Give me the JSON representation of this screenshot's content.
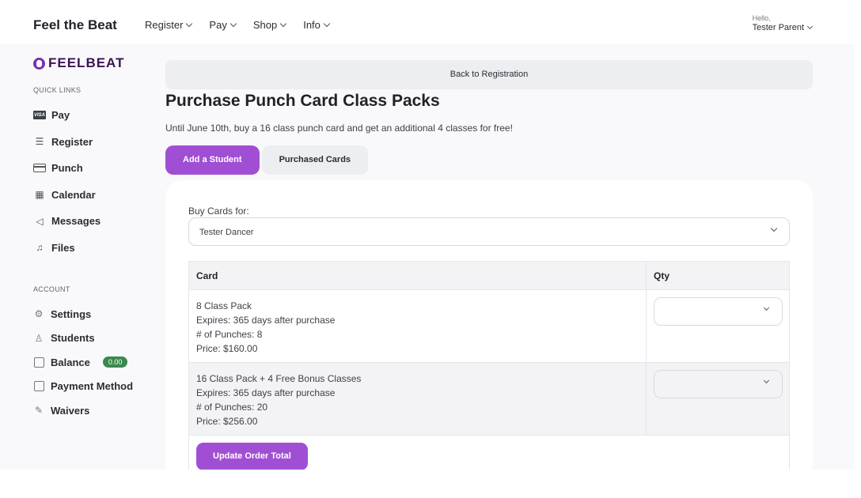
{
  "header": {
    "brand": "Feel the Beat",
    "nav": [
      "Register",
      "Pay",
      "Shop",
      "Info"
    ],
    "greeting": "Hello,",
    "user_name": "Tester Parent"
  },
  "sidebar": {
    "logo_text": "FEELBEAT",
    "quick_links_heading": "QUICK LINKS",
    "quick_links": [
      {
        "label": "Pay",
        "icon": "visa-card-icon"
      },
      {
        "label": "Register",
        "icon": "list-icon"
      },
      {
        "label": "Punch",
        "icon": "card-icon"
      },
      {
        "label": "Calendar",
        "icon": "calendar-icon"
      },
      {
        "label": "Messages",
        "icon": "megaphone-icon"
      },
      {
        "label": "Files",
        "icon": "music-note-icon"
      }
    ],
    "account_heading": "ACCOUNT",
    "account": [
      {
        "label": "Settings",
        "icon": "gear-icon"
      },
      {
        "label": "Students",
        "icon": "user-icon"
      },
      {
        "label": "Balance",
        "icon": "chart-icon",
        "badge": "0.00"
      },
      {
        "label": "Payment Method",
        "icon": "wallet-icon"
      },
      {
        "label": "Waivers",
        "icon": "edit-icon"
      }
    ],
    "badge_color": "#3a8a4c"
  },
  "main": {
    "back_label": "Back to Registration",
    "title": "Purchase Punch Card Class Packs",
    "promo": "Until June 10th, buy a 16 class punch card and get an additional 4 classes for free!",
    "tabs": [
      "Add a Student",
      "Purchased Cards"
    ],
    "buy_for_label": "Buy Cards for:",
    "buy_for_value": "Tester Dancer",
    "table": {
      "headers": [
        "Card",
        "Qty"
      ],
      "rows": [
        {
          "name": "8 Class Pack",
          "expires": "Expires: 365 days after purchase",
          "punches": "# of Punches: 8",
          "price": "Price: $160.00",
          "qty": ""
        },
        {
          "name": "16 Class Pack + 4 Free Bonus Classes",
          "expires": "Expires: 365 days after purchase",
          "punches": "# of Punches: 20",
          "price": "Price: $256.00",
          "qty": ""
        }
      ]
    },
    "update_button": "Update Order Total",
    "accent_color": "#a04fd4"
  }
}
